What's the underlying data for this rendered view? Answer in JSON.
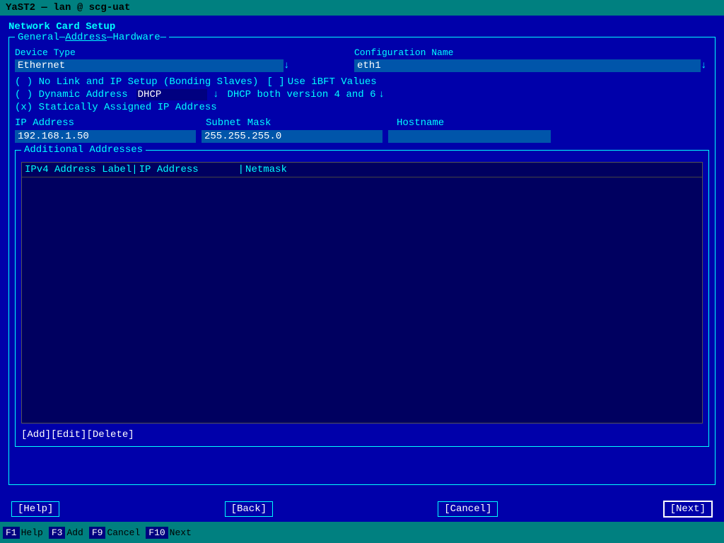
{
  "titlebar": {
    "text": "YaST2 — lan @ scg-uat"
  },
  "page": {
    "title": "Network Card Setup"
  },
  "tabs": {
    "general": "General",
    "address": "Address",
    "hardware": "Hardware",
    "separator1": "—",
    "separator2": "—"
  },
  "form": {
    "device_type_label": "Device Type",
    "config_name_label": "Configuration Name",
    "device_type_value": "Ethernet",
    "device_type_dropdown": "↓",
    "config_name_value": "eth1",
    "config_name_dropdown": "↓",
    "no_link_radio": "( ) No Link and IP Setup (Bonding Slaves)",
    "ibft_checkbox": "[ ]",
    "ibft_label": "Use iBFT Values",
    "dynamic_radio": "( ) Dynamic Address",
    "dhcp_value": "DHCP",
    "dhcp_dropdown": "↓",
    "dhcp_desc": "DHCP both version 4 and 6",
    "dhcp_desc_arrow": "↓",
    "static_radio": "(x) Statically Assigned IP Address",
    "ip_label": "IP Address",
    "mask_label": "Subnet Mask",
    "hostname_label": "Hostname",
    "ip_value": "192.168.1.50",
    "mask_value": "255.255.255.0",
    "hostname_value": ""
  },
  "additional": {
    "legend": "Additional Addresses",
    "table": {
      "col1": "IPv4 Address Label",
      "sep1": "|",
      "col2": "IP Address",
      "sep2": "|",
      "col3": "Netmask"
    },
    "buttons": {
      "add": "[Add]",
      "edit": "[Edit]",
      "delete": "[Delete]"
    }
  },
  "nav": {
    "help": "[Help]",
    "back": "[Back]",
    "cancel": "[Cancel]",
    "next": "[Next]"
  },
  "fkeys": [
    {
      "key": "F1",
      "label": "Help"
    },
    {
      "key": "F3",
      "label": "Add"
    },
    {
      "key": "F9",
      "label": "Cancel"
    },
    {
      "key": "F10",
      "label": "Next"
    }
  ]
}
